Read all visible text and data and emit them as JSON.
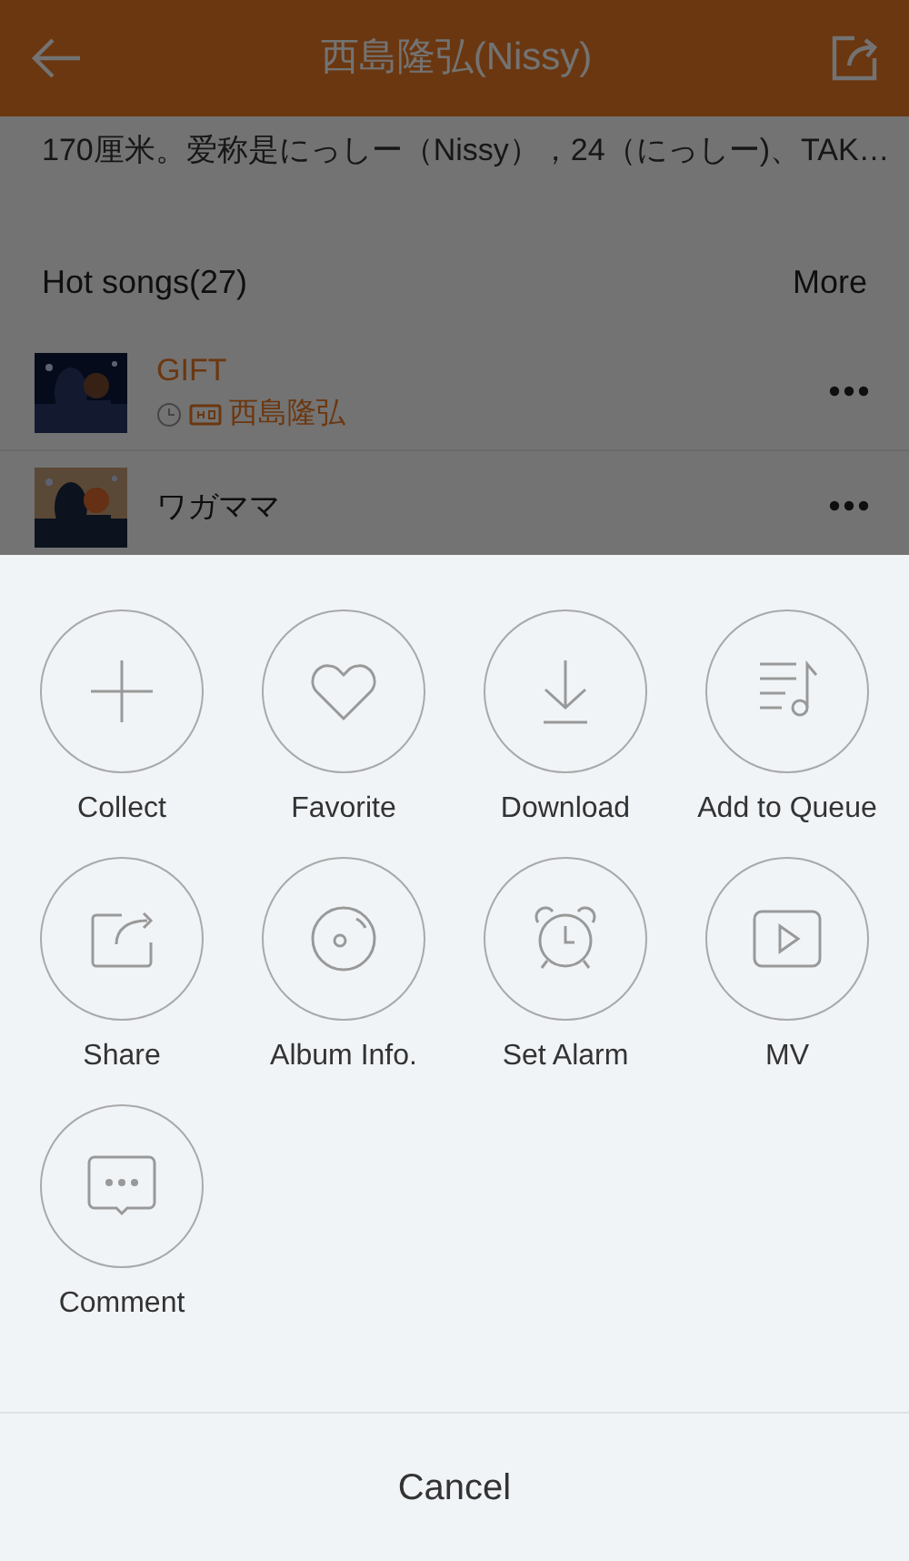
{
  "header": {
    "title": "西島隆弘(Nissy)"
  },
  "bio": "170厘米。爱称是にっしー（Nissy），24（にっしー)、TAK…",
  "section": {
    "title": "Hot songs(27)",
    "more": "More"
  },
  "songs": [
    {
      "title": "GIFT",
      "artist": "西島隆弘",
      "selected": true
    },
    {
      "title": "ワガママ",
      "selected": false
    }
  ],
  "actions": [
    {
      "label": "Collect",
      "kind": "plus"
    },
    {
      "label": "Favorite",
      "kind": "heart"
    },
    {
      "label": "Download",
      "kind": "download"
    },
    {
      "label": "Add to Queue",
      "kind": "queue"
    },
    {
      "label": "Share",
      "kind": "share"
    },
    {
      "label": "Album Info.",
      "kind": "disc"
    },
    {
      "label": "Set Alarm",
      "kind": "alarm"
    },
    {
      "label": "MV",
      "kind": "video"
    },
    {
      "label": "Comment",
      "kind": "comment"
    }
  ],
  "cancel": "Cancel"
}
